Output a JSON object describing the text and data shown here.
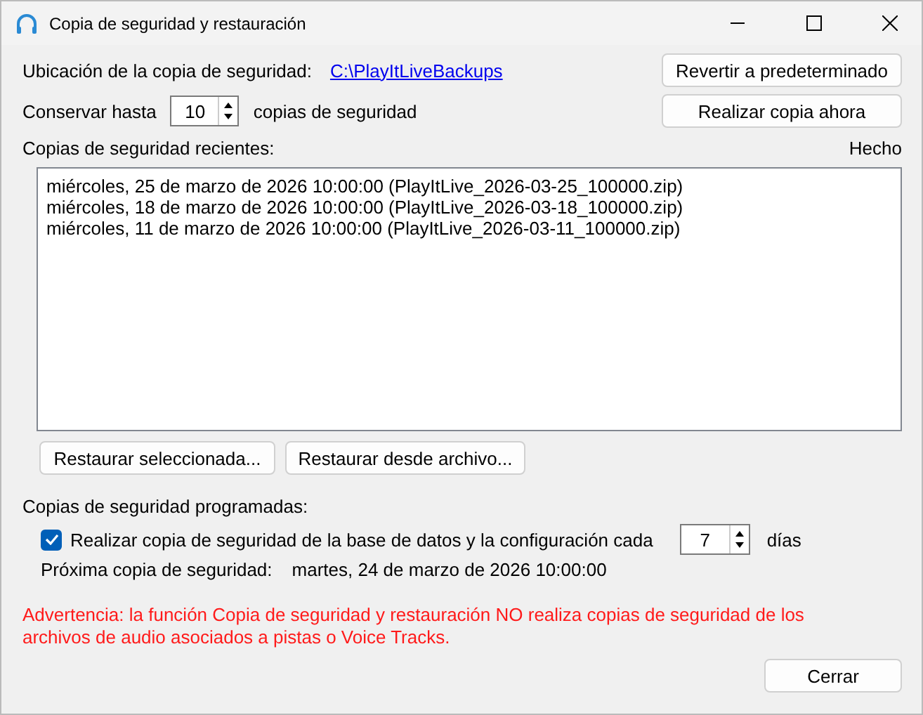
{
  "window": {
    "title": "Copia de seguridad y restauración"
  },
  "location": {
    "label": "Ubicación de la copia de seguridad:",
    "link": "C:\\PlayItLiveBackups"
  },
  "keep": {
    "label": "Conservar hasta",
    "value": "10",
    "suffix": "copias de seguridad"
  },
  "top_buttons": [
    "Revertir a predeterminado",
    "Realizar copia ahora"
  ],
  "recent": {
    "label": "Copias de seguridad recientes:",
    "status": "Hecho",
    "items": [
      {
        "text": "miércoles, 25 de marzo de 2026 10:00:00 (PlayItLive_2026-03-25_100000.zip)",
        "selected": false
      },
      {
        "text": "miércoles, 18 de marzo de 2026 10:00:00 (PlayItLive_2026-03-18_100000.zip)",
        "selected": false
      },
      {
        "text": "miércoles, 11 de marzo de 2026 10:00:00 (PlayItLive_2026-03-11_100000.zip)",
        "selected": false
      }
    ],
    "buttons": [
      "Restaurar seleccionada...",
      "Restaurar desde archivo..."
    ]
  },
  "scheduled": {
    "label": "Copias de seguridad programadas:",
    "checkbox_label": "Realizar copia de seguridad de la base de datos y la configuración cada",
    "checked": true,
    "days_value": "7",
    "days_suffix": "días",
    "next_label": "Próxima copia de seguridad:",
    "next_value": "martes, 24 de marzo de 2026 10:00:00"
  },
  "warning": "Advertencia: la función Copia de seguridad y restauración NO realiza copias de seguridad de los archivos de audio asociados a pistas o Voice Tracks.",
  "close_button": "Cerrar"
}
